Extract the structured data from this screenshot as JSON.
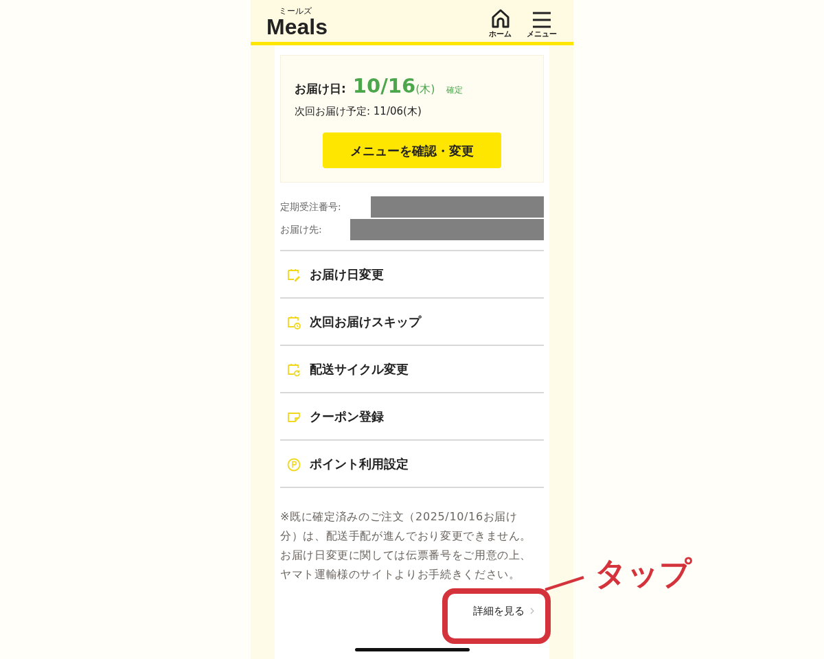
{
  "header": {
    "logo_ruby": "ミールズ",
    "logo": "Meals",
    "nav": [
      {
        "kind": "home",
        "label": "ホーム"
      },
      {
        "kind": "menu",
        "label": "メニュー"
      }
    ]
  },
  "delivery": {
    "label": "お届け日:",
    "date": "10/16",
    "weekday": "(木)",
    "status": "確定",
    "next": "次回お届け予定: 11/06(木)",
    "button": "メニューを確認・変更"
  },
  "order_info": [
    {
      "label": "定期受注番号:"
    },
    {
      "label": "お届け先:"
    }
  ],
  "menu_items": [
    {
      "kind": "date-edit",
      "label": "お届け日変更"
    },
    {
      "kind": "skip",
      "label": "次回お届けスキップ"
    },
    {
      "kind": "cycle",
      "label": "配送サイクル変更"
    },
    {
      "kind": "coupon",
      "label": "クーポン登録"
    },
    {
      "kind": "point",
      "label": "ポイント利用設定"
    }
  ],
  "note": "※既に確定済みのご注文（2025/10/16お届け分）は、配送手配が進んでおり変更できません。お届け日変更に関しては伝票番号をご用意の上、ヤマト運輸様のサイトよりお手続きください。",
  "detail_link": "詳細を見る",
  "annotation": {
    "label": "タップ"
  }
}
